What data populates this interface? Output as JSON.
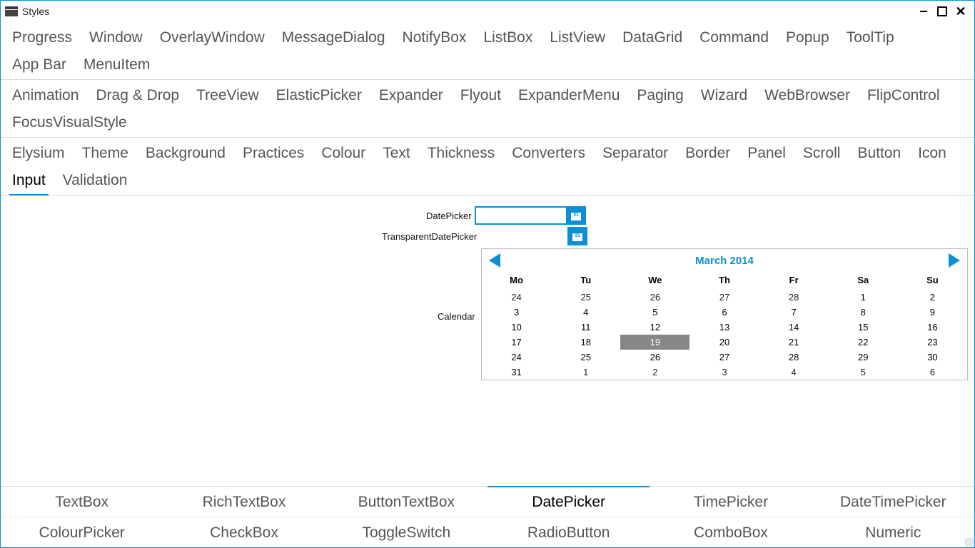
{
  "window": {
    "title": "Styles"
  },
  "topTabs": {
    "row1": [
      "Progress",
      "Window",
      "OverlayWindow",
      "MessageDialog",
      "NotifyBox",
      "ListBox",
      "ListView",
      "DataGrid",
      "Command",
      "Popup",
      "ToolTip",
      "App Bar",
      "MenuItem"
    ],
    "row2": [
      "Animation",
      "Drag & Drop",
      "TreeView",
      "ElasticPicker",
      "Expander",
      "Flyout",
      "ExpanderMenu",
      "Paging",
      "Wizard",
      "WebBrowser",
      "FlipControl",
      "FocusVisualStyle"
    ],
    "row3": [
      "Elysium",
      "Theme",
      "Background",
      "Practices",
      "Colour",
      "Text",
      "Thickness",
      "Converters",
      "Separator",
      "Border",
      "Panel",
      "Scroll",
      "Button",
      "Icon",
      "Input",
      "Validation"
    ],
    "row3_selected": "Input"
  },
  "form": {
    "datepicker_label": "DatePicker",
    "datepicker_value": "",
    "transparent_label": "TransparentDatePicker",
    "calendar_label": "Calendar"
  },
  "calendar": {
    "title": "March 2014",
    "days": [
      "Mo",
      "Tu",
      "We",
      "Th",
      "Fr",
      "Sa",
      "Su"
    ],
    "weeks": [
      [
        {
          "n": "24",
          "o": true
        },
        {
          "n": "25",
          "o": true
        },
        {
          "n": "26",
          "o": true
        },
        {
          "n": "27",
          "o": true
        },
        {
          "n": "28",
          "o": true
        },
        {
          "n": "1"
        },
        {
          "n": "2"
        }
      ],
      [
        {
          "n": "3"
        },
        {
          "n": "4"
        },
        {
          "n": "5"
        },
        {
          "n": "6"
        },
        {
          "n": "7"
        },
        {
          "n": "8"
        },
        {
          "n": "9"
        }
      ],
      [
        {
          "n": "10"
        },
        {
          "n": "11"
        },
        {
          "n": "12"
        },
        {
          "n": "13"
        },
        {
          "n": "14"
        },
        {
          "n": "15"
        },
        {
          "n": "16"
        }
      ],
      [
        {
          "n": "17"
        },
        {
          "n": "18"
        },
        {
          "n": "19",
          "t": true
        },
        {
          "n": "20"
        },
        {
          "n": "21"
        },
        {
          "n": "22"
        },
        {
          "n": "23"
        }
      ],
      [
        {
          "n": "24"
        },
        {
          "n": "25"
        },
        {
          "n": "26"
        },
        {
          "n": "27"
        },
        {
          "n": "28"
        },
        {
          "n": "29"
        },
        {
          "n": "30"
        }
      ],
      [
        {
          "n": "31"
        },
        {
          "n": "1",
          "o": true
        },
        {
          "n": "2",
          "o": true
        },
        {
          "n": "3",
          "o": true
        },
        {
          "n": "4",
          "o": true
        },
        {
          "n": "5",
          "o": true
        },
        {
          "n": "6",
          "o": true
        }
      ]
    ]
  },
  "bottomTabs": {
    "row1": [
      "TextBox",
      "RichTextBox",
      "ButtonTextBox",
      "DatePicker",
      "TimePicker",
      "DateTimePicker"
    ],
    "row1_selected": "DatePicker",
    "row2": [
      "ColourPicker",
      "CheckBox",
      "ToggleSwitch",
      "RadioButton",
      "ComboBox",
      "Numeric"
    ]
  }
}
